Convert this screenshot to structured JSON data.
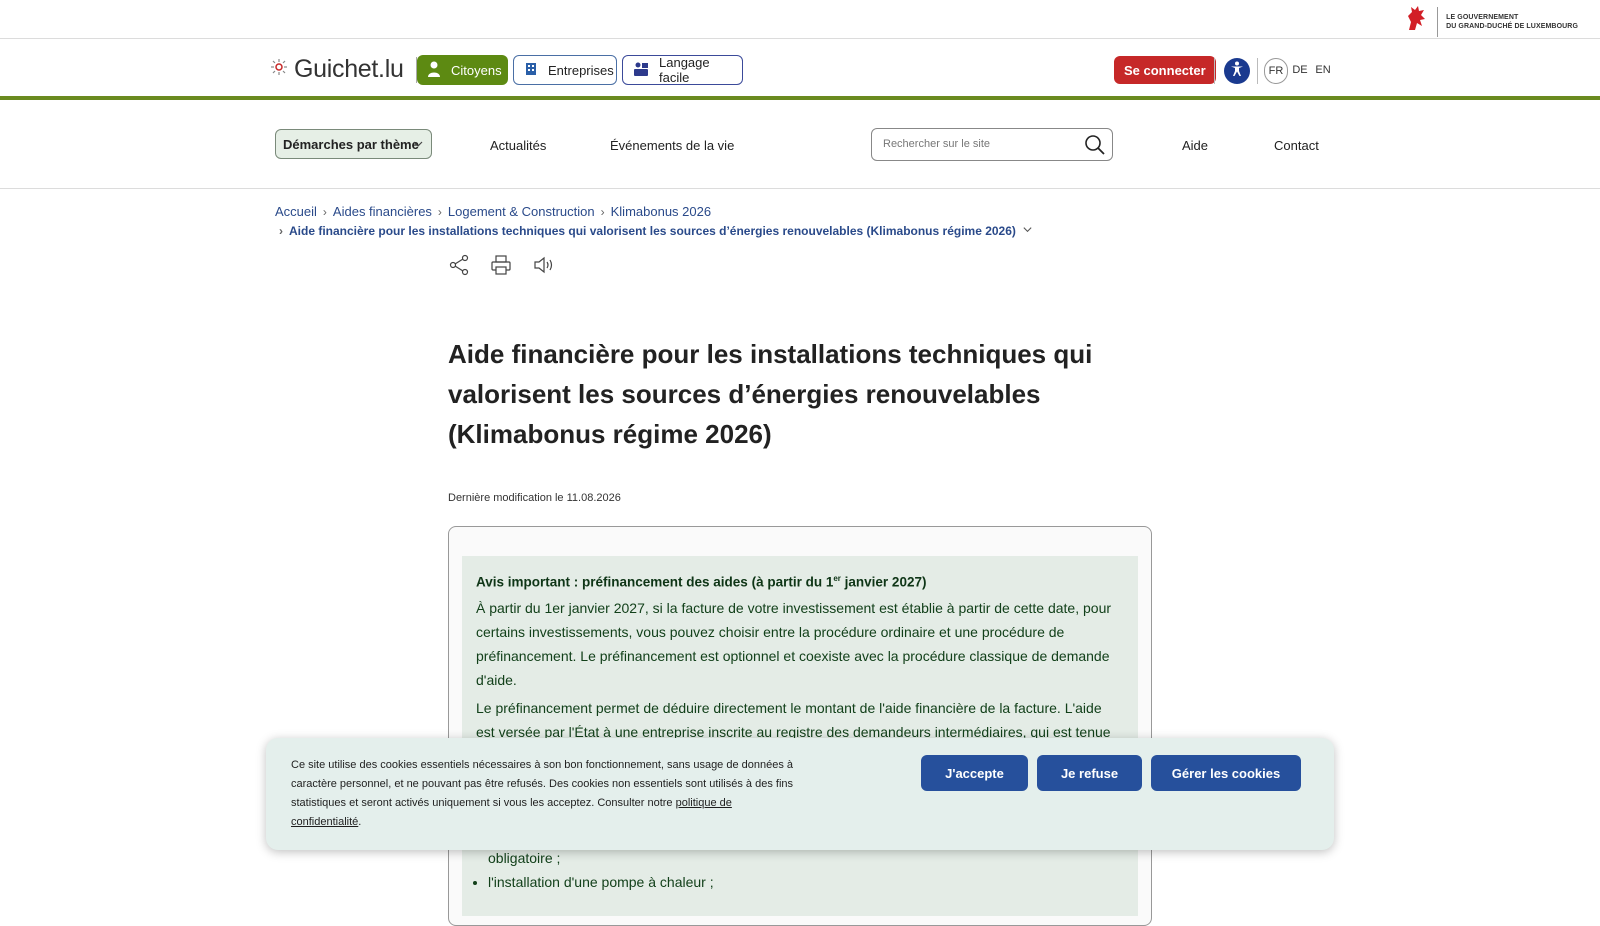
{
  "gov": {
    "line1": "LE GOUVERNEMENT",
    "line2": "DU GRAND-DUCHÉ DE LUXEMBOURG",
    "logo_icon": "red-lion-icon"
  },
  "header": {
    "brand": "Guichet.lu",
    "segments": [
      {
        "label": "Citoyens",
        "icon": "person-icon"
      },
      {
        "label": "Entreprises",
        "icon": "building-icon"
      },
      {
        "label": "Langage facile",
        "icon": "easy-read-icon"
      }
    ],
    "connect_label": "Se connecter",
    "languages": [
      "FR",
      "DE",
      "EN"
    ],
    "accent_color": "#5d8a12"
  },
  "nav": {
    "theme_label": "Démarches par thème",
    "links": [
      "Actualités",
      "Événements de la vie"
    ],
    "search_placeholder": "Rechercher sur le site",
    "right_links": [
      "Aide",
      "Contact"
    ]
  },
  "breadcrumb": {
    "items": [
      "Accueil",
      "Aides financières",
      "Logement & Construction",
      "Klimabonus 2026"
    ],
    "current": "Aide financière pour les installations techniques qui valorisent les sources d’énergies renouvelables (Klimabonus régime 2026)"
  },
  "page": {
    "title": "Aide financière pour les installations techniques qui valorisent les sources d’énergies renouvelables (Klimabonus régime 2026)",
    "last_modified_label": "Dernière modification le",
    "last_modified_date": "11.08.2026"
  },
  "notice": {
    "heading_pre": "Avis important : préfinancement des aides (à partir du 1",
    "heading_sup": "er",
    "heading_post": " janvier 2027)",
    "para1": "À partir du 1er janvier 2027, si la facture de votre investissement est établie à partir de cette date, pour certains investissements, vous pouvez choisir entre la procédure ordinaire et une procédure de préfinancement. Le préfinancement est optionnel et coexiste avec la procédure classique de demande d'aide.",
    "para2": "Le préfinancement permet de déduire directement le montant de l'aide financière de la facture. L'aide est versée par l'État à une entreprise inscrite au registre des demandeurs intermédiaires, qui est tenue",
    "bullet1": "obligatoire ;",
    "bullet2": "l'installation d'une pompe à chaleur ;"
  },
  "cookie": {
    "text": "Ce site utilise des cookies essentiels nécessaires à son bon fonctionnement, sans usage de données à caractère personnel, et ne pouvant pas être refusés. Des cookies non essentiels sont utilisés à des fins statistiques et seront activés uniquement si vous les acceptez. Consulter notre ",
    "link": "politique de confidentialité",
    "end": ".",
    "accept": "J'accepte",
    "refuse": "Je refuse",
    "manage": "Gérer les cookies"
  }
}
